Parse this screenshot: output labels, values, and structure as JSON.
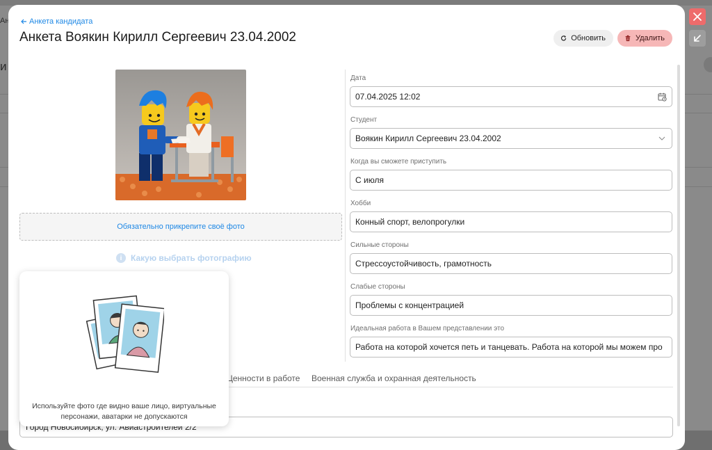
{
  "background": {
    "left_fragment_1": "Ан",
    "left_fragment_2": "и"
  },
  "window_controls": {
    "close_icon": "x-icon",
    "minimize_icon": "arrow-down-left-icon"
  },
  "header": {
    "back_link": "Анкета кандидата",
    "title": "Анкета Воякин Кирилл Сергеевич 23.04.2002",
    "refresh_label": "Обновить",
    "delete_label": "Удалить"
  },
  "photo": {
    "upload_hint": "Обязательно прикрепите своё фото",
    "choose_link": "Какую выбрать фотографию"
  },
  "form": {
    "date_label": "Дата",
    "date_value": "07.04.2025 12:02",
    "student_label": "Студент",
    "student_value": "Воякин Кирилл Сергеевич 23.04.2002",
    "start_label": "Когда вы сможете приступить",
    "start_value": "С июля",
    "hobby_label": "Хобби",
    "hobby_value": "Конный спорт, велопрогулки",
    "strengths_label": "Сильные стороны",
    "strengths_value": "Стрессоустойчивость, грамотность",
    "weaknesses_label": "Слабые стороны",
    "weaknesses_value": "Проблемы с концентрацией",
    "ideal_job_label": "Идеальная работа в Вашем представлении это",
    "ideal_job_value": "Работа на которой хочется петь и танцевать. Работа на которой мы можем про"
  },
  "tabs": [
    {
      "label": "Ценности в работе"
    },
    {
      "label": "Военная служба и охранная деятельность"
    }
  ],
  "address_value": "Город Новосибирск, ул. Авиастроителей 2/2",
  "tooltip": {
    "text": "Используйте фото где видно ваше лицо, виртуальные персонажи, аватарки не допускаются"
  },
  "colors": {
    "accent": "#1e88e5",
    "delete_bg": "#f6b7b7",
    "close_button": "#ee6b6b"
  }
}
